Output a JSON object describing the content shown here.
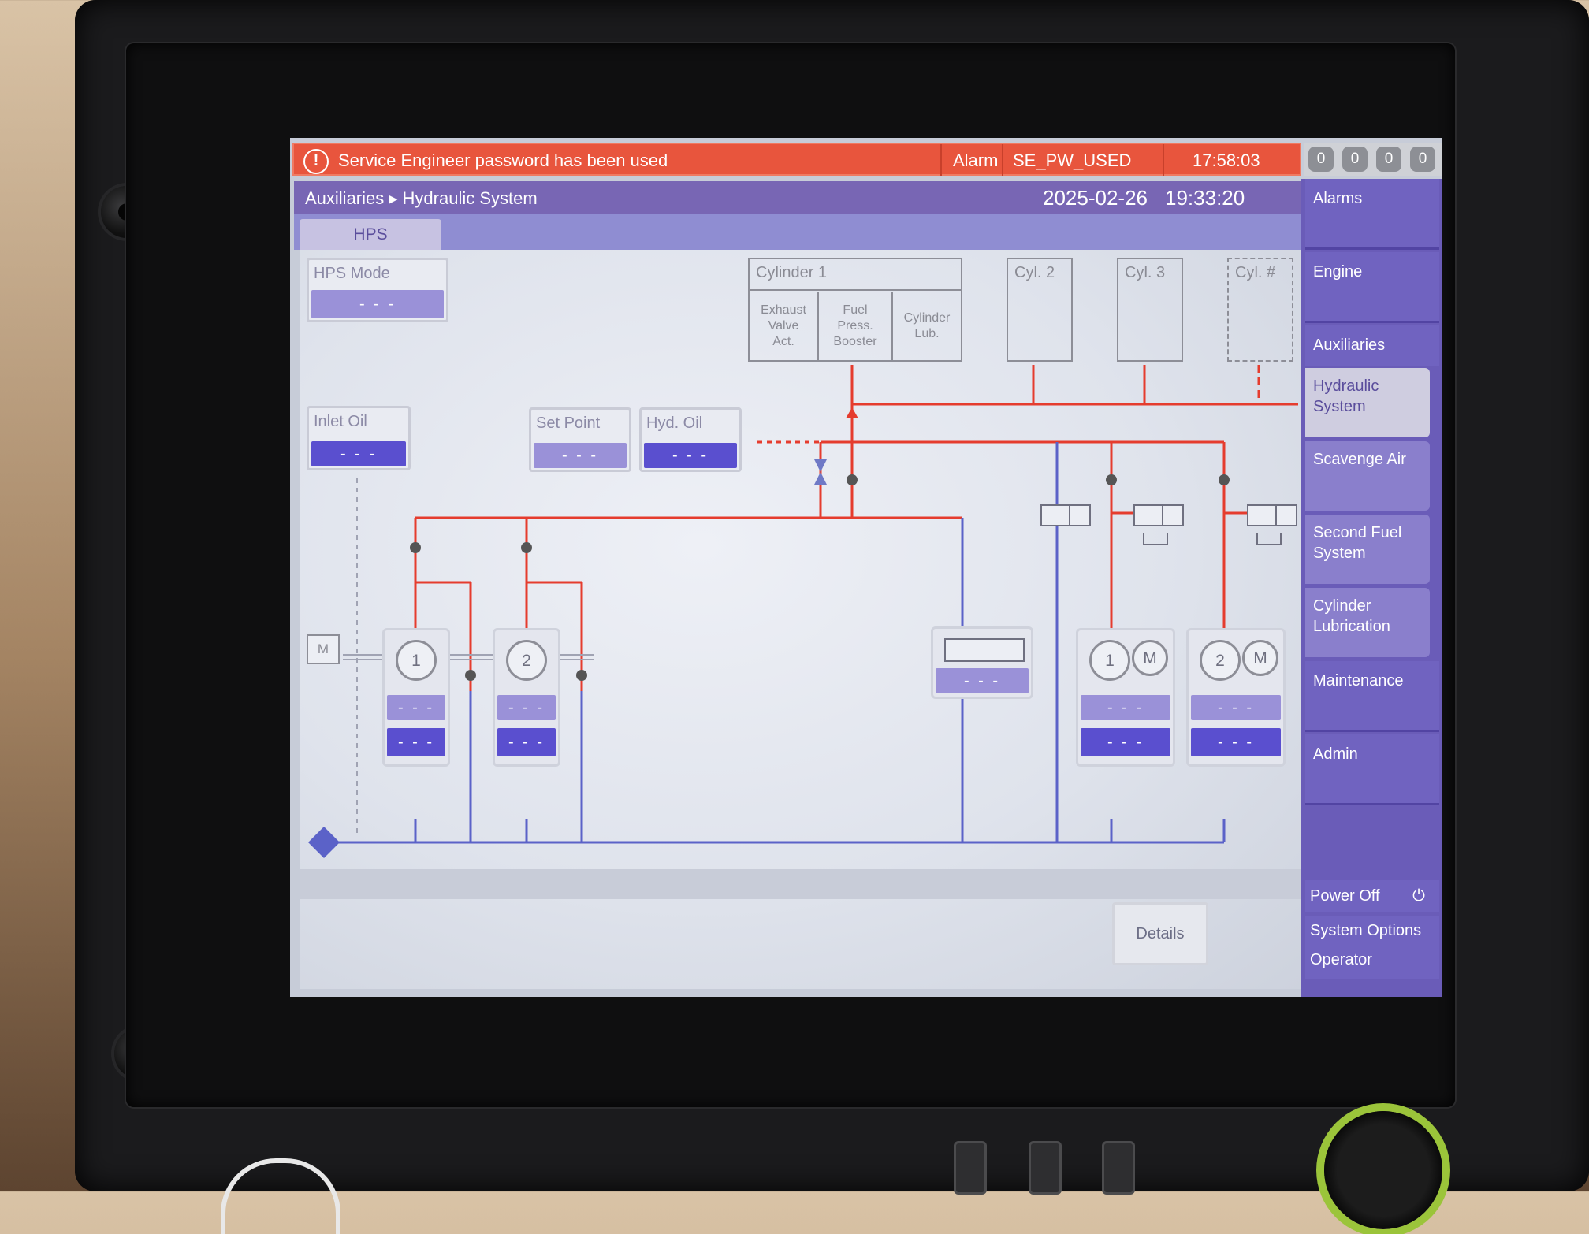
{
  "alarm": {
    "icon": "exclamation-circle-icon",
    "message": "Service Engineer password has been used",
    "type": "Alarm",
    "code": "SE_PW_USED",
    "time": "17:58:03",
    "counters": [
      "0",
      "0",
      "0",
      "0"
    ]
  },
  "header": {
    "breadcrumb": "Auxiliaries ▸ Hydraulic System",
    "date": "2025-02-26",
    "time": "19:33:20"
  },
  "tabs": [
    {
      "label": "HPS"
    }
  ],
  "main": {
    "hps_mode": {
      "label": "HPS Mode",
      "value": "- - -"
    },
    "inlet_oil": {
      "label": "Inlet Oil",
      "value": "- - -"
    },
    "set_point": {
      "label": "Set Point",
      "value": "- - -"
    },
    "hyd_oil": {
      "label": "Hyd. Oil",
      "value": "- - -"
    },
    "cylinder1": {
      "title": "Cylinder 1",
      "cells": [
        "Exhaust\nValve\nAct.",
        "Fuel\nPress.\nBooster",
        "Cylinder\nLub."
      ]
    },
    "cyl2": "Cyl. 2",
    "cyl3": "Cyl. 3",
    "cylN": "Cyl. #",
    "motor_label": "M",
    "engine_pumps": [
      {
        "number": "1",
        "value1": "- - -",
        "value2": "- - -"
      },
      {
        "number": "2",
        "value1": "- - -",
        "value2": "- - -"
      }
    ],
    "valve_value": "- - -",
    "electric_pumps": [
      {
        "number": "1",
        "motor": "M",
        "value1": "- - -",
        "value2": "- - -"
      },
      {
        "number": "2",
        "motor": "M",
        "value1": "- - -",
        "value2": "- - -"
      }
    ],
    "details_button": "Details"
  },
  "nav": {
    "items": [
      "Alarms",
      "Engine",
      "Auxiliaries"
    ],
    "sub_items": [
      "Hydraulic System",
      "Scavenge Air",
      "Second Fuel System",
      "Cylinder Lubrication"
    ],
    "items2": [
      "Maintenance",
      "Admin"
    ],
    "power_off": "Power Off",
    "system_options": "System Options",
    "operator": "Operator"
  },
  "colors": {
    "alarm_bar": "#e8553d",
    "header": "#7866b4",
    "nav": "#6a5cb8",
    "pressure_line": "#e53c2e",
    "return_line": "#5b62c8",
    "value_light": "#9a91d8",
    "value_dark": "#5a4fcf"
  }
}
